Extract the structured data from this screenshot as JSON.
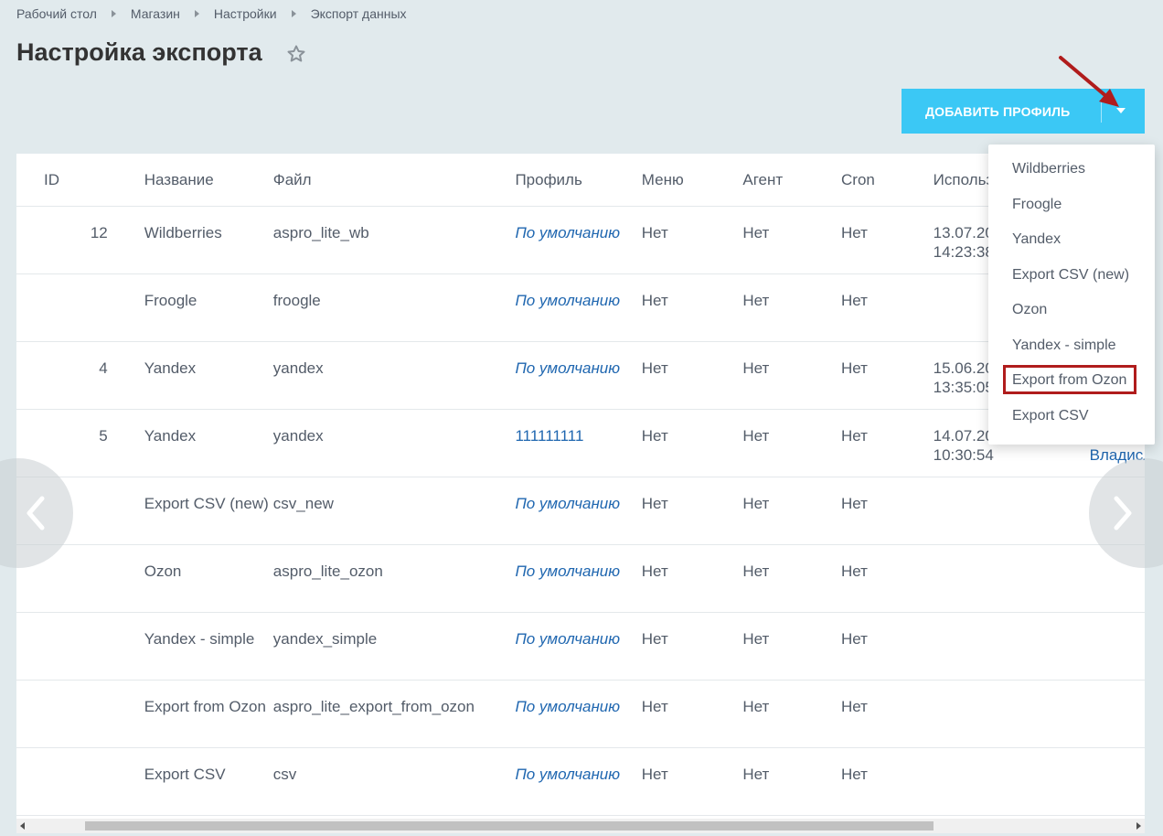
{
  "breadcrumb": [
    "Рабочий стол",
    "Магазин",
    "Настройки",
    "Экспорт данных"
  ],
  "page_title": "Настройка экспорта",
  "add_button": {
    "label": "ДОБАВИТЬ ПРОФИЛЬ"
  },
  "table": {
    "headers": [
      "ID",
      "Название",
      "Файл",
      "Профиль",
      "Меню",
      "Агент",
      "Cron",
      "Использ"
    ],
    "rows": [
      {
        "id": "12",
        "name": "Wildberries",
        "file": "aspro_lite_wb",
        "profile": "По умолчанию",
        "menu": "Нет",
        "agent": "Нет",
        "cron": "Нет",
        "used1": "13.07.20",
        "used2": "14:23:38"
      },
      {
        "id": "",
        "name": "Froogle",
        "file": "froogle",
        "profile": "По умолчанию",
        "menu": "Нет",
        "agent": "Нет",
        "cron": "Нет",
        "used1": "",
        "used2": ""
      },
      {
        "id": "4",
        "name": "Yandex",
        "file": "yandex",
        "profile": "По умолчанию",
        "menu": "Нет",
        "agent": "Нет",
        "cron": "Нет",
        "used1": "15.06.20",
        "used2": "13:35:05"
      },
      {
        "id": "5",
        "name": "Yandex",
        "file": "yandex",
        "profile": "111111111",
        "menu": "Нет",
        "agent": "Нет",
        "cron": "Нет",
        "used1": "14.07.20",
        "used2": "10:30:54",
        "user": "Владисл"
      },
      {
        "id": "",
        "name": "Export CSV (new)",
        "file": "csv_new",
        "profile": "По умолчанию",
        "menu": "Нет",
        "agent": "Нет",
        "cron": "Нет",
        "used1": "",
        "used2": ""
      },
      {
        "id": "",
        "name": "Ozon",
        "file": "aspro_lite_ozon",
        "profile": "По умолчанию",
        "menu": "Нет",
        "agent": "Нет",
        "cron": "Нет",
        "used1": "",
        "used2": ""
      },
      {
        "id": "",
        "name": "Yandex - simple",
        "file": "yandex_simple",
        "profile": "По умолчанию",
        "menu": "Нет",
        "agent": "Нет",
        "cron": "Нет",
        "used1": "",
        "used2": ""
      },
      {
        "id": "",
        "name": "Export from Ozon",
        "file": "aspro_lite_export_from_ozon",
        "profile": "По умолчанию",
        "menu": "Нет",
        "agent": "Нет",
        "cron": "Нет",
        "used1": "",
        "used2": ""
      },
      {
        "id": "",
        "name": "Export CSV",
        "file": "csv",
        "profile": "По умолчанию",
        "menu": "Нет",
        "agent": "Нет",
        "cron": "Нет",
        "used1": "",
        "used2": ""
      }
    ]
  },
  "dropdown": {
    "items": [
      "Wildberries",
      "Froogle",
      "Yandex",
      "Export CSV (new)",
      "Ozon",
      "Yandex - simple",
      "Export from Ozon",
      "Export CSV"
    ],
    "highlighted": "Export from Ozon"
  },
  "colors": {
    "accent": "#3bc8f5",
    "link": "#2067b0",
    "highlight": "#b01c1c",
    "background": "#e1eaed"
  },
  "icons": {
    "favorite": "star-icon",
    "expand": "chevron-down-icon",
    "prev": "chevron-left-icon",
    "next": "chevron-right-icon"
  }
}
